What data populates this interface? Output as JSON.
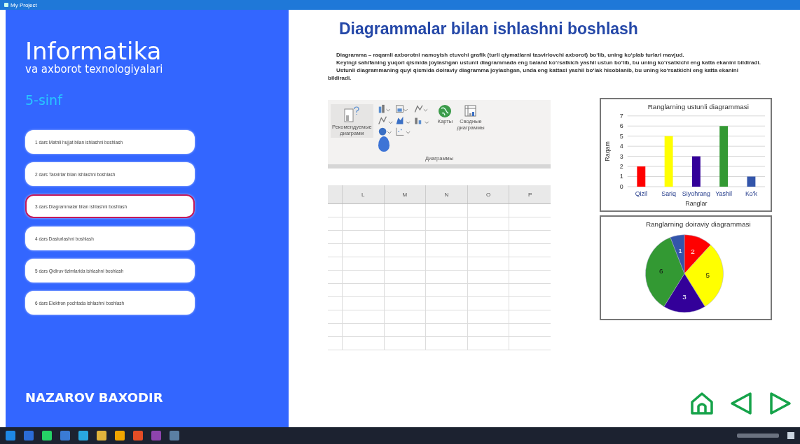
{
  "window": {
    "title": "My Project"
  },
  "sidebar": {
    "title": "Informatika",
    "subtitle": "va axborot texnologiyalari",
    "grade": "5-sinf",
    "lessons": [
      {
        "label": "1 dars Matnli hujjat bilan ishlashni boshlash",
        "selected": false
      },
      {
        "label": "2 dars Tasvirlar bilan ishlashni boshlash",
        "selected": false
      },
      {
        "label": "3 dars Diagrammalar bilan ishlashni boshlash",
        "selected": true
      },
      {
        "label": "4 dars Dasturlashni boshlash",
        "selected": false
      },
      {
        "label": "5 dars Qidiruv tizimlarida ishlashni boshlash",
        "selected": false
      },
      {
        "label": "6 dars Elektron pochtada ishlashni boshlash",
        "selected": false
      }
    ],
    "author": "NAZAROV BAXODIR"
  },
  "page": {
    "heading": "Diagrammalar bilan ishlashni boshlash",
    "paragraphs": [
      "Diagramma – raqamli axborotni namoyish etuvchi grafik (turli qiymatlarni tasvirlovchi axborot) bo‘lib, uning ko‘plab turlari mavjud.",
      "Keyingi sahifaning yuqori qismida joylashgan ustunli diagrammada eng baland ko‘rsatkich yashil ustun bo‘lib, bu uning ko‘rsatkichi eng katta ekanini bildiradi.",
      "Ustunli diagrammaning quyi qismida doiraviy diagramma joylashgan, unda eng kattasi yashil bo‘lak hisoblanib, bu uning ko‘rsatkichi eng katta ekanini bildiradi."
    ],
    "ribbon": {
      "recommended": [
        "Рекомендуемые",
        "диаграмм"
      ],
      "maps": "Карты",
      "pivot": [
        "Сводные",
        "диаграммы"
      ],
      "group": "Диаграммы"
    },
    "sheet": {
      "columns": [
        "L",
        "M",
        "N",
        "O",
        "P"
      ]
    },
    "bar_chart": {
      "chart_data": {
        "type": "bar",
        "title": "Ranglarning ustunli diagrammasi",
        "xlabel": "Ranglar",
        "ylabel": "Raqam",
        "categories": [
          "Qizil",
          "Sariq",
          "Siyohrang",
          "Yashil",
          "Ko'k"
        ],
        "series": [
          {
            "values": [
              2,
              5,
              3,
              6,
              1
            ]
          }
        ],
        "colors": [
          "#ff0000",
          "#ffff00",
          "#330099",
          "#339933",
          "#3355aa"
        ],
        "grid": true,
        "ylim": [
          0,
          7
        ],
        "yticks": [
          0,
          1,
          2,
          3,
          4,
          5,
          6,
          7
        ]
      }
    },
    "pie_chart": {
      "chart_data": {
        "type": "pie",
        "title": "Ranglarning doiraviy diagrammasi",
        "series": [
          {
            "values": [
              2,
              5,
              3,
              6,
              1
            ]
          }
        ],
        "colors": [
          "#ff0000",
          "#ffff00",
          "#330099",
          "#339933",
          "#3355aa"
        ],
        "data_labels": true
      }
    }
  }
}
